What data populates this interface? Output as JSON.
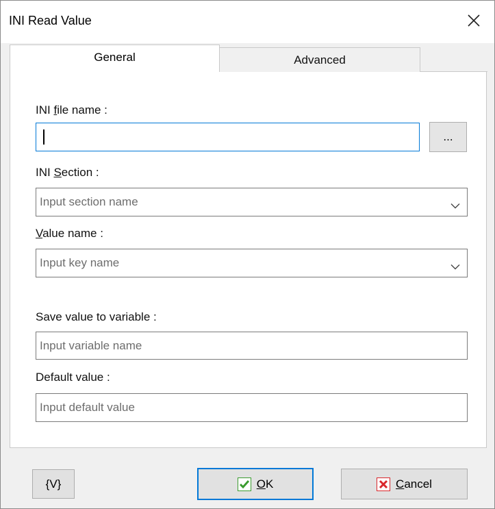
{
  "window": {
    "title": "INI Read Value"
  },
  "tabs": [
    {
      "label": "General",
      "active": true
    },
    {
      "label": "Advanced",
      "active": false
    }
  ],
  "form": {
    "ini_file": {
      "label_pre": "INI ",
      "label_ul": "f",
      "label_post": "ile name :",
      "value": "",
      "browse_label": "..."
    },
    "ini_section": {
      "label_pre": "INI ",
      "label_ul": "S",
      "label_post": "ection :",
      "placeholder": "Input section name"
    },
    "value_name": {
      "label_pre": "",
      "label_ul": "V",
      "label_post": "alue name :",
      "placeholder": "Input key name"
    },
    "save_var": {
      "label": "Save value to variable :",
      "placeholder": "Input variable name"
    },
    "default_value": {
      "label": "Default value :",
      "placeholder": "Input default value"
    }
  },
  "footer": {
    "variables_label": "{V}",
    "ok_ul": "O",
    "ok_rest": "K",
    "cancel_ul": "C",
    "cancel_rest": "ancel"
  },
  "icons": {
    "ok": "green-checkmark-icon",
    "cancel": "red-x-icon",
    "close": "close-icon",
    "dropdown": "chevron-down-icon"
  },
  "colors": {
    "focus_border": "#0078d7",
    "check_green": "#3a9b2e",
    "cancel_red": "#d9262b"
  }
}
